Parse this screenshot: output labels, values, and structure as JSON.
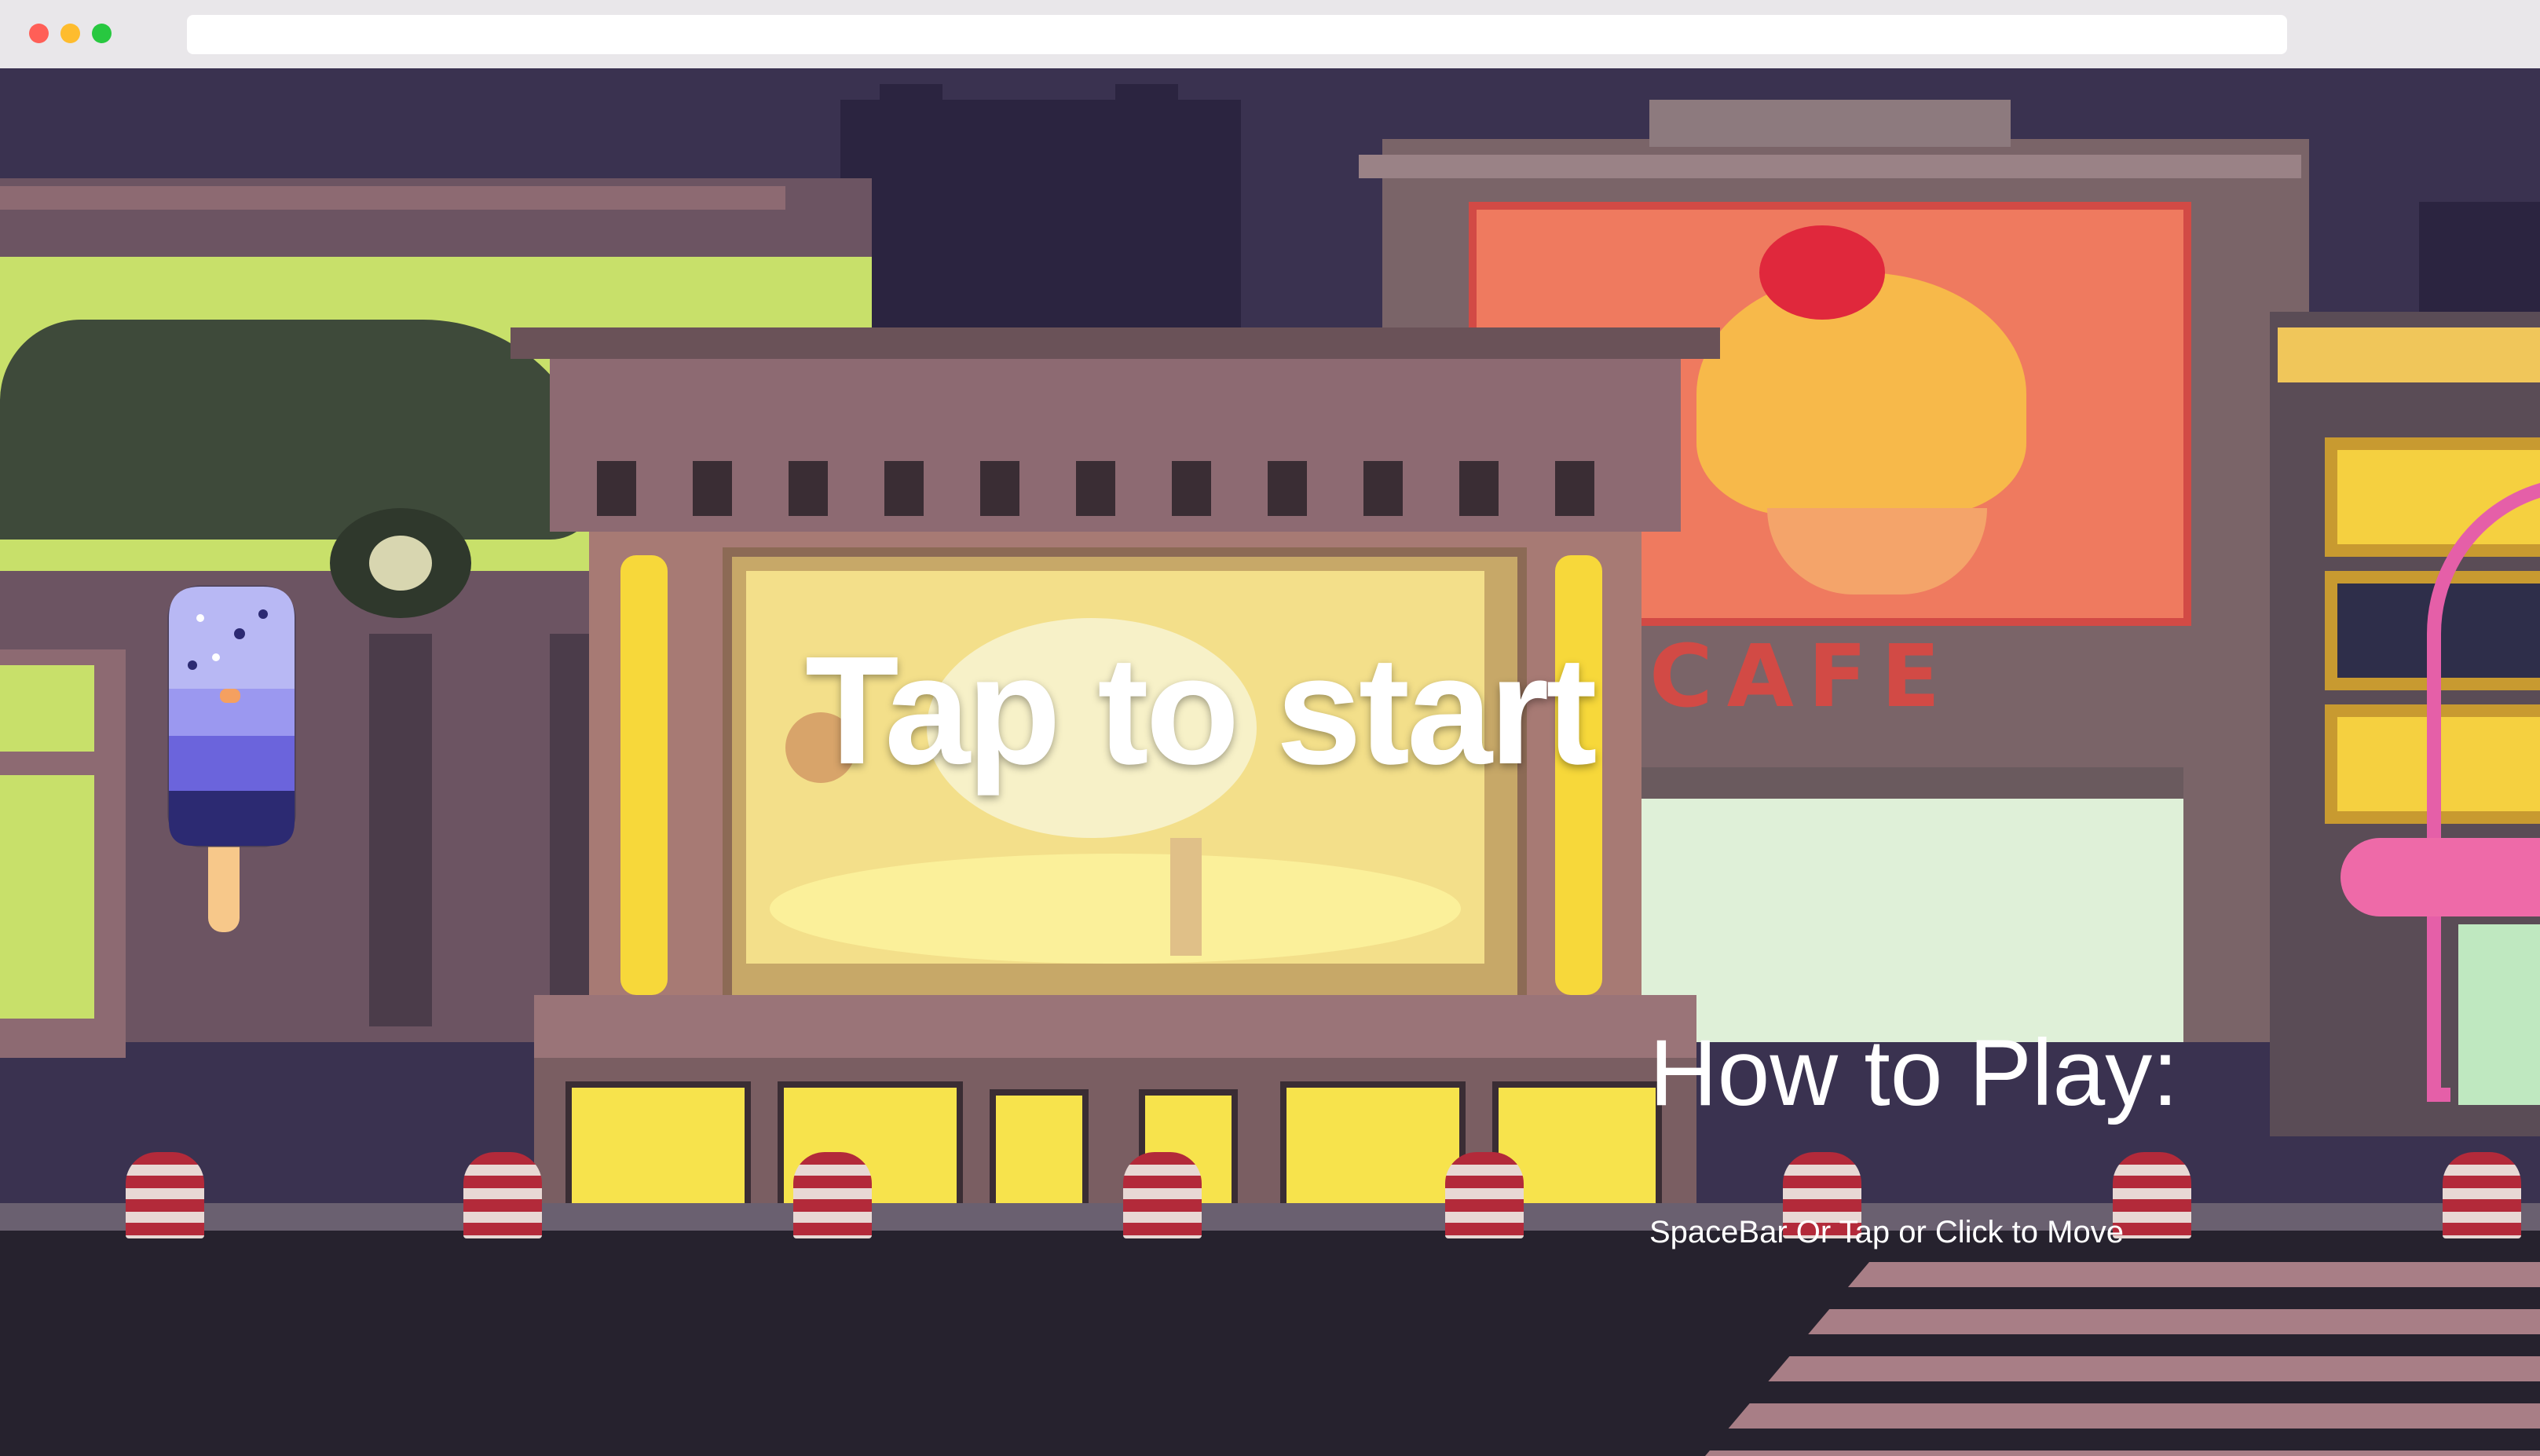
{
  "browser": {
    "traffic_lights": [
      "#ff5f57",
      "#febc2e",
      "#28c840"
    ],
    "url": ""
  },
  "game": {
    "start_prompt": "Tap to start",
    "how_to_play": {
      "title": "How to Play:",
      "instruction": "SpaceBar Or Tap or Click to Move"
    },
    "cafe_sign": "CAFE",
    "player": "popsicle-character-icon"
  },
  "colors": {
    "sky": "#3a3250",
    "street": "#26222e",
    "lime": "#c8e06a",
    "billboard_orange": "#ef7a5f",
    "marquee_yellow": "#f7e86c",
    "building_mauve": "#8d6a72",
    "crosswalk": "#a87e86",
    "popsicle_purple": "#7f7ce8",
    "neon_pink": "#e55fa8"
  }
}
